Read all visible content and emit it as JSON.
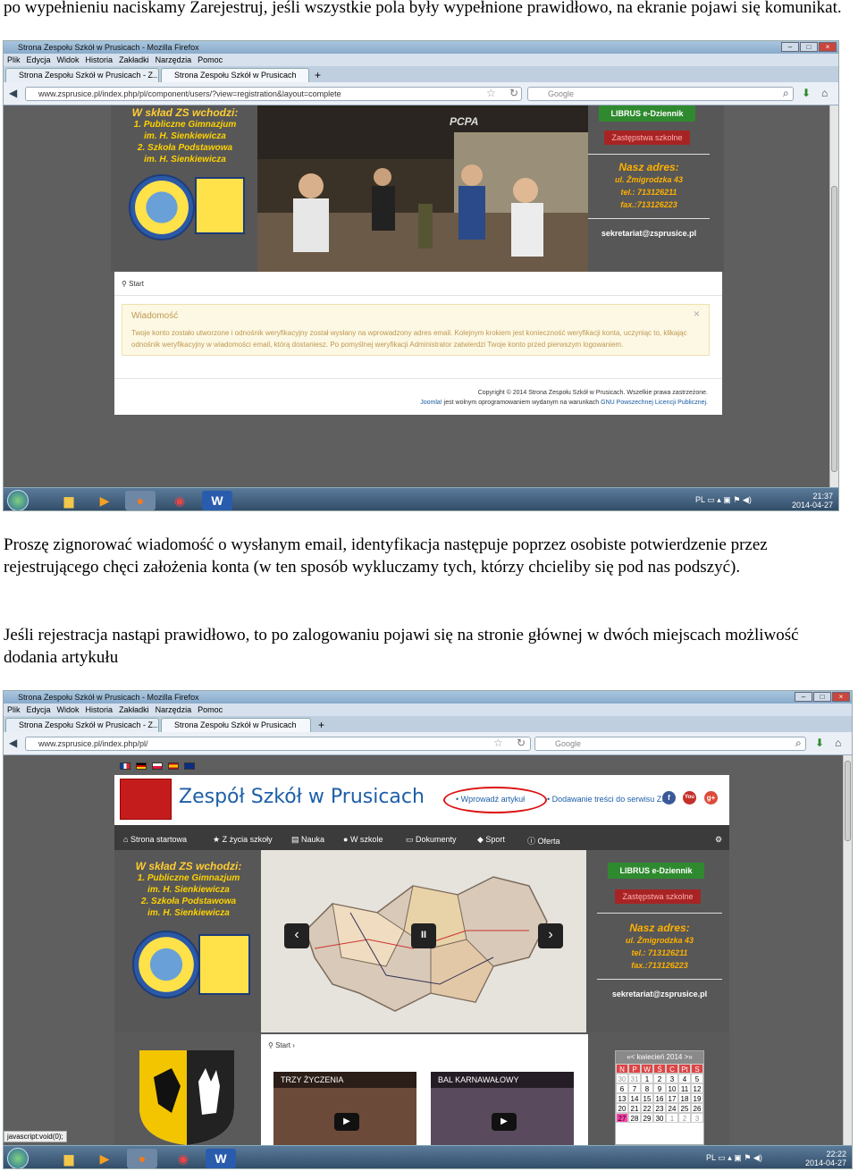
{
  "text": {
    "p1": "po wypełnieniu naciskamy Zarejestruj, jeśli wszystkie pola były wypełnione prawidłowo, na ekranie pojawi się komunikat.",
    "p2": "Proszę zignorować wiadomość o wysłanym email, identyfikacja następuje poprzez osobiste potwierdzenie przez rejestrującego chęci założenia konta (w ten sposób wykluczamy tych, którzy chcieliby się pod nas podszyć).",
    "p3": "Jeśli rejestracja nastąpi prawidłowo, to po zalogowaniu pojawi się na stronie głównej w dwóch miejscach możliwość dodania artykułu"
  },
  "browser": {
    "window_title": "Strona Zespołu Szkół w Prusicach - Mozilla Firefox",
    "menu": [
      "Plik",
      "Edycja",
      "Widok",
      "Historia",
      "Zakładki",
      "Narzędzia",
      "Pomoc"
    ],
    "search_placeholder": "Google",
    "new_tab": "+"
  },
  "shot1": {
    "tab1": "Strona Zespołu Szkół w Prusicach - Z...",
    "tab2": "Strona Zespołu Szkół w Prusicach",
    "url": "www.zsprusice.pl/index.php/pl/component/users/?view=registration&layout=complete",
    "time": "21:37",
    "date": "2014-04-27",
    "lang": "PL"
  },
  "shot2": {
    "tab1": "Strona Zespołu Szkół w Prusicach - Z...",
    "tab2": "Strona Zespołu Szkół w Prusicach",
    "url": "www.zsprusice.pl/index.php/pl/",
    "time": "22:22",
    "date": "2014-04-27",
    "lang": "PL",
    "status": "javascript:void(0);"
  },
  "school": {
    "heading": "W skład ZS wchodzi:",
    "line1": "1. Publiczne Gimnazjum",
    "line2": "im. H. Sienkiewicza",
    "line3": "2. Szkoła Podstawowa",
    "line4": "im. H. Sienkiewicza",
    "librus": "LIBRUS e-Dziennik",
    "substitutes": "Zastępstwa szkolne",
    "addr_heading": "Nasz adres:",
    "addr_street": "ul. Żmigrodzka 43",
    "addr_tel": "tel.: 713126211",
    "addr_fax": "fax.:713126223",
    "email": "sekretariat@zsprusice.pl",
    "crumb": "Start",
    "photo_sign": "PCPA"
  },
  "alert": {
    "title": "Wiadomość",
    "body": "Twoje konto zostało utworzone i odnośnik weryfikacyjny został wysłany na wprowadzony adres email. Kolejnym krokiem jest konieczność weryfikacji konta, uczyniąc to, klikając odnośnik weryfikacyjny w wiadomości email, którą dostaniesz. Po pomyślnej weryfikacji Administrator zatwierdzi Twoje konto przed pierwszym logowaniem.",
    "close": "×"
  },
  "footer": {
    "copyright": "Copyright © 2014 Strona Zespołu Szkół w Prusicach. Wszelkie prawa zastrzeżone.",
    "joomla": "Joomla!",
    "joomla_rest": " jest wolnym oprogramowaniem wydanym na warunkach ",
    "license": "GNU Powszechnej Licencji Publicznej."
  },
  "home": {
    "site_title": "Zespół Szkół w Prusicach",
    "link_add": "• Wprowadź artykuł",
    "link_submit": "• Dodawanie treści do serwisu ZS",
    "social": [
      "f",
      "You",
      "g+"
    ],
    "nav": [
      "Strona startowa",
      "Z życia szkoły",
      "Nauka",
      "W szkole",
      "Dokumenty",
      "Sport",
      "Oferta"
    ],
    "slide_prev": "‹",
    "slide_pause": "II",
    "slide_next": "›",
    "card1": "TRZY ŻYCZENIA",
    "card2": "BAL KARNAWAŁOWY",
    "calendar_title": "kwiecień 2014",
    "calendar_prev": "«<",
    "calendar_next": ">»",
    "weekdays": [
      "N",
      "P",
      "W",
      "Ś",
      "C",
      "Pt",
      "S"
    ],
    "days": [
      "30",
      "31",
      "1",
      "2",
      "3",
      "4",
      "5",
      "6",
      "7",
      "8",
      "9",
      "10",
      "11",
      "12",
      "13",
      "14",
      "15",
      "16",
      "17",
      "18",
      "19",
      "20",
      "21",
      "22",
      "23",
      "24",
      "25",
      "26",
      "27",
      "28",
      "29",
      "30",
      "1",
      "2",
      "3"
    ]
  },
  "colors": {
    "ellipse": "#dd1111",
    "accent_yellow": "#ffd200",
    "link_blue": "#1d5fa8"
  }
}
